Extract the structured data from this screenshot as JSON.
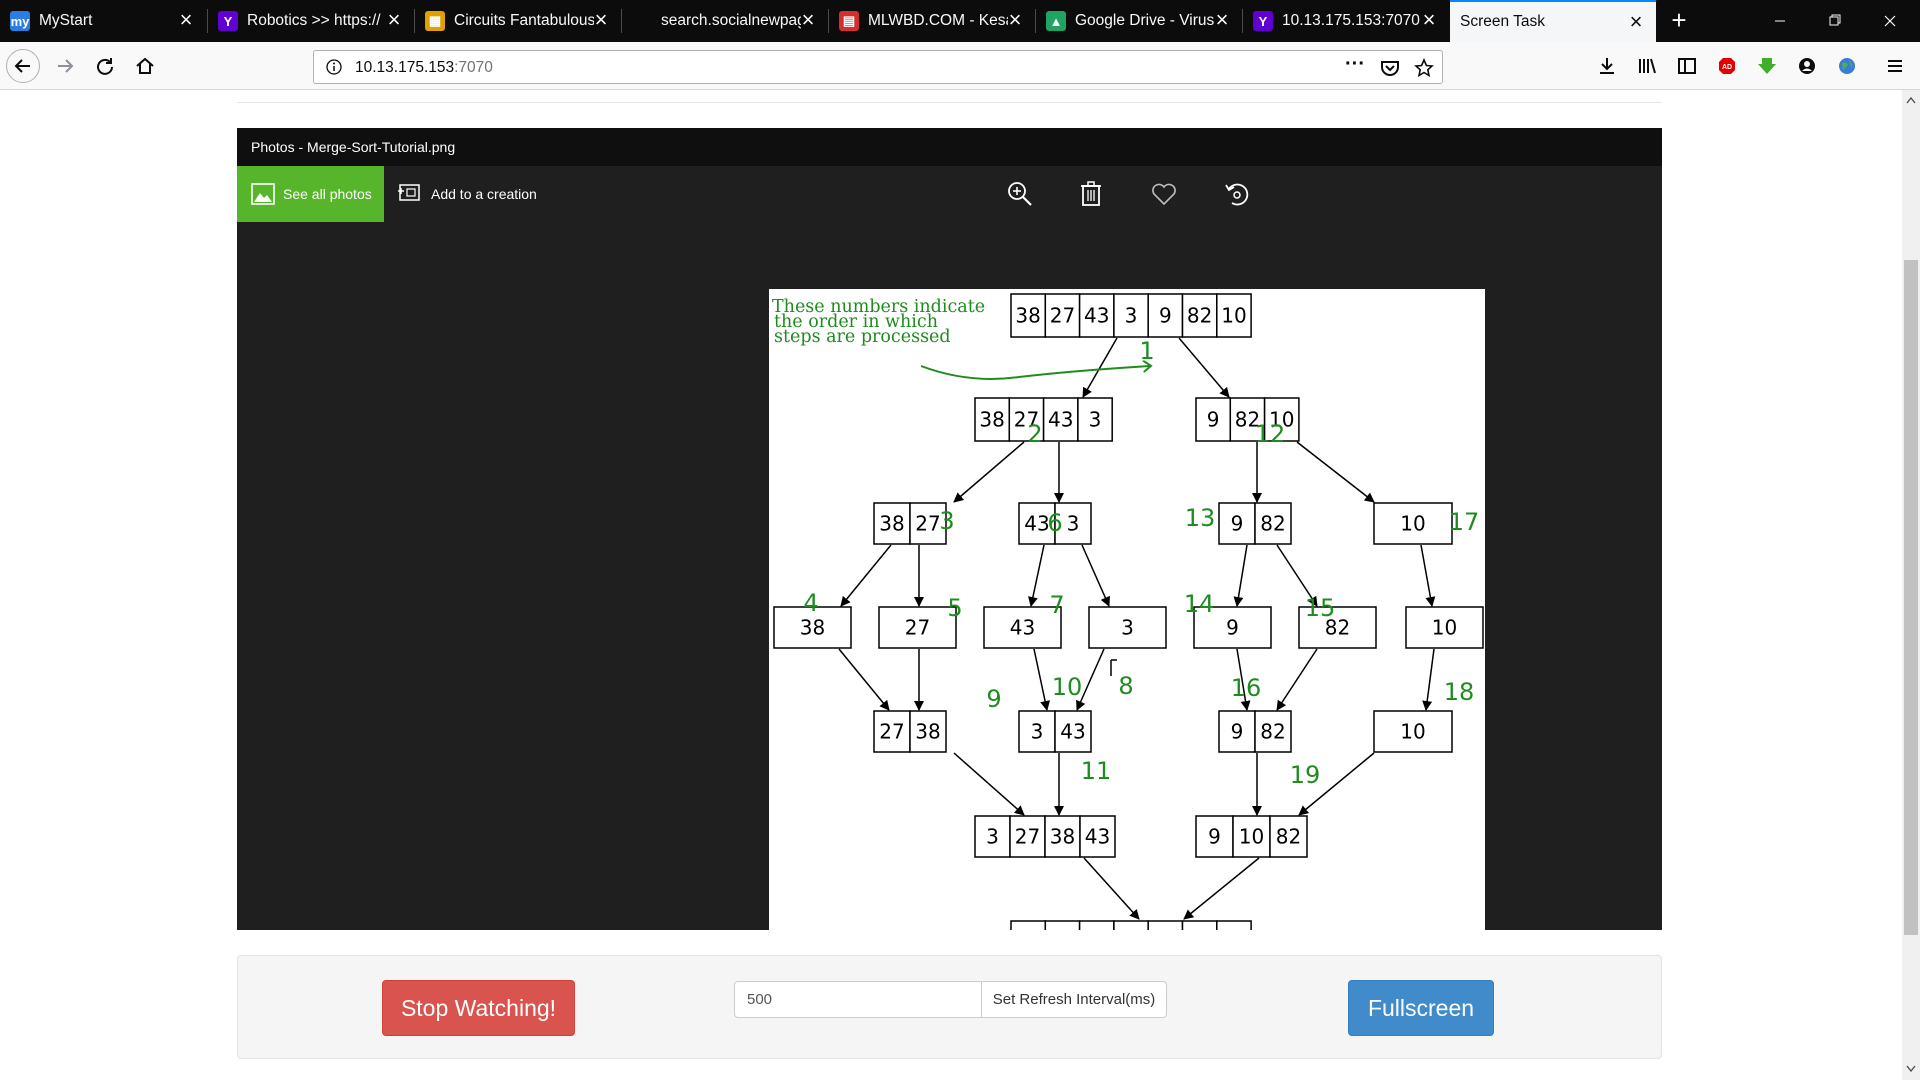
{
  "browser": {
    "tabs": [
      {
        "title": "MyStart",
        "icon": "mystart-icon",
        "color": "#2a7de1",
        "glyph": "my"
      },
      {
        "title": "Robotics >> https://",
        "icon": "yahoo-icon",
        "color": "#6001d2",
        "glyph": "Y"
      },
      {
        "title": "Circuits Fantabulous",
        "icon": "circuits-icon",
        "color": "#e0a000",
        "glyph": "▦"
      },
      {
        "title": "search.socialnewpag",
        "icon": "blank-icon",
        "color": "#0c0c0d",
        "glyph": ""
      },
      {
        "title": "MLWBD.COM - Kesa",
        "icon": "mlwbd-icon",
        "color": "#d32f2f",
        "glyph": "▤"
      },
      {
        "title": "Google Drive - Virus",
        "icon": "google-drive-icon",
        "color": "#1fa463",
        "glyph": "▲"
      },
      {
        "title": "10.13.175.153:7070",
        "icon": "yahoo-icon",
        "color": "#6001d2",
        "glyph": "Y"
      },
      {
        "title": "Screen Task",
        "icon": "",
        "color": "",
        "glyph": ""
      }
    ],
    "url_host": "10.13.175.153",
    "url_port": ":7070"
  },
  "viewer": {
    "title": "Photos - Merge-Sort-Tutorial.png",
    "see_all": "See all photos",
    "add_creation": "Add to a creation"
  },
  "diagram": {
    "note": [
      "These numbers indicate",
      "the order in which",
      "steps are processed"
    ],
    "root": [
      "38",
      "27",
      "43",
      "3",
      "9",
      "82",
      "10"
    ],
    "level1": [
      [
        "38",
        "27",
        "43",
        "3"
      ],
      [
        "9",
        "82",
        "10"
      ]
    ],
    "level2": [
      [
        "38",
        "27"
      ],
      [
        "43",
        "3"
      ],
      [
        "9",
        "82"
      ],
      [
        "10"
      ]
    ],
    "level3": [
      "38",
      "27",
      "43",
      "3",
      "9",
      "82",
      "10"
    ],
    "merge1": [
      [
        "27",
        "38"
      ],
      [
        "3",
        "43"
      ],
      [
        "9",
        "82"
      ],
      [
        "10"
      ]
    ],
    "merge2": [
      [
        "3",
        "27",
        "38",
        "43"
      ],
      [
        "9",
        "10",
        "82"
      ]
    ],
    "steps": [
      "1",
      "2",
      "3",
      "4",
      "5",
      "6",
      "7",
      "8",
      "9",
      "10",
      "11",
      "12",
      "13",
      "14",
      "15",
      "16",
      "17",
      "18",
      "19"
    ]
  },
  "controls": {
    "stop": "Stop Watching!",
    "interval_value": "500",
    "set_interval": "Set Refresh Interval(ms)",
    "fullscreen": "Fullscreen"
  }
}
